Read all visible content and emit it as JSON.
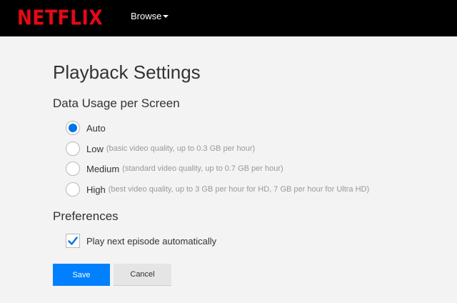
{
  "header": {
    "logo_text": "NETFLIX",
    "browse_label": "Browse",
    "colors": {
      "background": "#000000",
      "logo": "#e50914"
    }
  },
  "page": {
    "title": "Playback Settings"
  },
  "data_usage": {
    "heading": "Data Usage per Screen",
    "selected": "Auto",
    "options": [
      {
        "label": "Auto",
        "description": ""
      },
      {
        "label": "Low",
        "description": "(basic video quality, up to 0.3 GB per hour)"
      },
      {
        "label": "Medium",
        "description": "(standard video quality, up to 0.7 GB per hour)"
      },
      {
        "label": "High",
        "description": "(best video quality, up to 3 GB per hour for HD, 7 GB per hour for Ultra HD)"
      }
    ]
  },
  "preferences": {
    "heading": "Preferences",
    "autoplay_label": "Play next episode automatically",
    "autoplay_checked": true
  },
  "actions": {
    "save_label": "Save",
    "cancel_label": "Cancel",
    "colors": {
      "primary": "#0080ff",
      "secondary": "#e5e5e5",
      "radio_selected": "#0073e6"
    }
  }
}
